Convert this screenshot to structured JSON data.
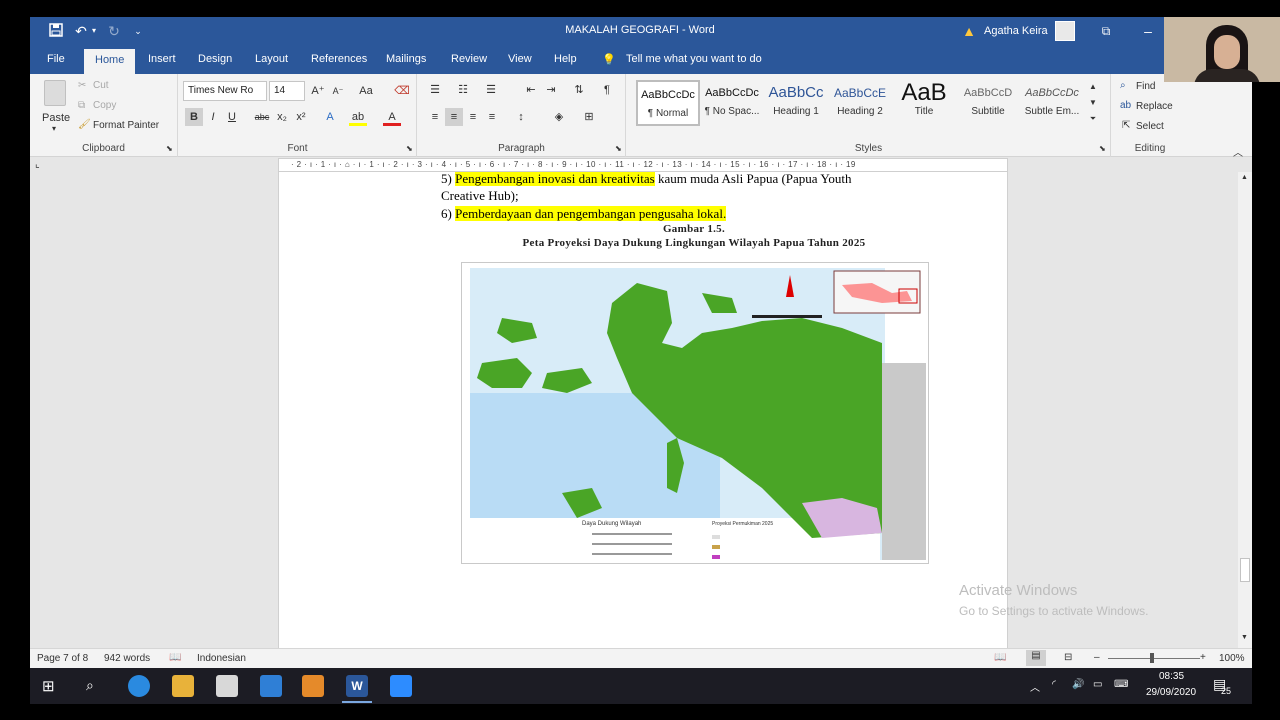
{
  "window": {
    "title": "MAKALAH GEOGRAFI  -  Word",
    "user": "Agatha Keira"
  },
  "tabs": [
    "File",
    "Home",
    "Insert",
    "Design",
    "Layout",
    "References",
    "Mailings",
    "Review",
    "View",
    "Help"
  ],
  "tellme": "Tell me what you want to do",
  "clipboard": {
    "paste": "Paste",
    "cut": "Cut",
    "copy": "Copy",
    "format_painter": "Format Painter",
    "label": "Clipboard"
  },
  "font": {
    "name": "Times New Ro",
    "size": "14",
    "label": "Font",
    "aa": "Aa"
  },
  "paragraph": {
    "label": "Paragraph"
  },
  "styles": {
    "label": "Styles",
    "items": [
      {
        "preview": "AaBbCcDc",
        "name": "¶ Normal"
      },
      {
        "preview": "AaBbCcDc",
        "name": "¶ No Spac..."
      },
      {
        "preview": "AaBbCc",
        "name": "Heading 1"
      },
      {
        "preview": "AaBbCcE",
        "name": "Heading 2"
      },
      {
        "preview": "AaB",
        "name": "Title"
      },
      {
        "preview": "AaBbCcD",
        "name": "Subtitle"
      },
      {
        "preview": "AaBbCcDc",
        "name": "Subtle Em..."
      }
    ]
  },
  "editing": {
    "find": "Find",
    "replace": "Replace",
    "select": "Select",
    "label": "Editing"
  },
  "ruler": "· 2 · ı · 1 · ı · ⌂ · ı · 1 · ı · 2 · ı · 3 · ı · 4 · ı · 5 · ı · 6 · ı · 7 · ı · 8 · ı · 9 · ı · 10 · ı · 11 · ı · 12 · ı · 13 · ı · 14 · ı · 15 · ı · 16 · ı · 17 · ı · 18 · ı · 19",
  "document": {
    "line1_num": "5) ",
    "line1_hl": "Pengembangan inovasi dan kreativitas",
    "line1_rest": " kaum muda Asli Papua (Papua Youth",
    "line2": "Creative Hub);",
    "line3_num": "6) ",
    "line3_hl": "Pemberdayaan dan pengembangan pengusaha lokal.",
    "caption1": "Gambar 1.5.",
    "caption2": "Peta Proyeksi Daya Dukung Lingkungan Wilayah Papua Tahun 2025"
  },
  "map": {
    "legend_title": "Daya Dukung Wilayah",
    "legend_col2": "Proyeksi Permukiman 2025"
  },
  "status": {
    "page": "Page 7 of 8",
    "words": "942 words",
    "language": "Indonesian",
    "zoom": "100%"
  },
  "watermark": {
    "line1": "Activate Windows",
    "line2": "Go to Settings to activate Windows."
  },
  "taskbar": {
    "time": "08:35",
    "date": "29/09/2020",
    "notif": "25"
  }
}
